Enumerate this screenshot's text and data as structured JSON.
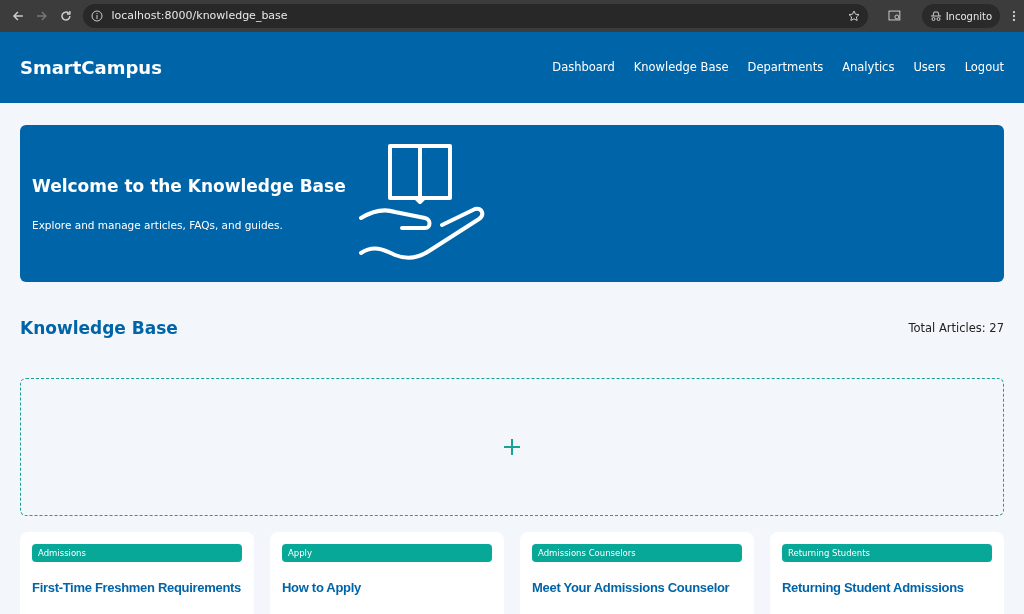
{
  "browser": {
    "url": "localhost:8000/knowledge_base",
    "profile": "Incognito"
  },
  "header": {
    "brand": "SmartCampus",
    "nav": [
      {
        "label": "Dashboard"
      },
      {
        "label": "Knowledge Base"
      },
      {
        "label": "Departments"
      },
      {
        "label": "Analytics"
      },
      {
        "label": "Users"
      },
      {
        "label": "Logout"
      }
    ]
  },
  "hero": {
    "title": "Welcome to the Knowledge Base",
    "subtitle": "Explore and manage articles, FAQs, and guides."
  },
  "section": {
    "title": "Knowledge Base",
    "total": "Total Articles: 27"
  },
  "articles": [
    {
      "tag": "Admissions",
      "title": "First-Time Freshmen Requirements"
    },
    {
      "tag": "Apply",
      "title": "How to Apply"
    },
    {
      "tag": "Admissions Counselors",
      "title": "Meet Your Admissions Counselor"
    },
    {
      "tag": "Returning Students",
      "title": "Returning Student Admissions"
    }
  ]
}
